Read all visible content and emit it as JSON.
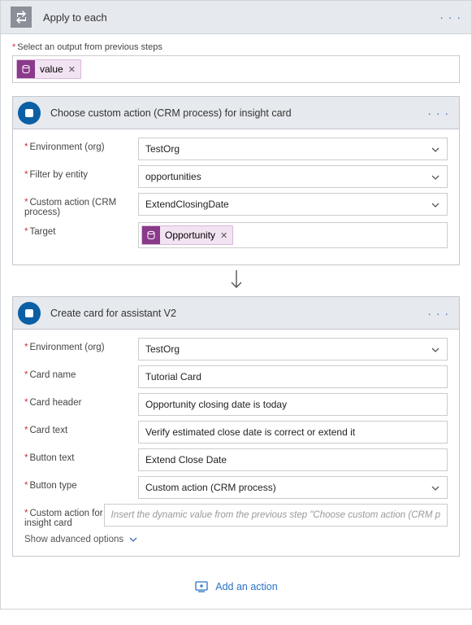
{
  "outer": {
    "title": "Apply to each",
    "selectLabel": "Select an output from previous steps",
    "pill": "value"
  },
  "action1": {
    "title": "Choose custom action (CRM process) for insight card",
    "env_label": "Environment (org)",
    "env_value": "TestOrg",
    "filter_label": "Filter by entity",
    "filter_value": "opportunities",
    "custom_label": "Custom action (CRM process)",
    "custom_value": "ExtendClosingDate",
    "target_label": "Target",
    "target_pill": "Opportunity"
  },
  "action2": {
    "title": "Create card for assistant V2",
    "env_label": "Environment (org)",
    "env_value": "TestOrg",
    "cardname_label": "Card name",
    "cardname_value": "Tutorial Card",
    "cardheader_label": "Card header",
    "cardheader_value": "Opportunity closing date is today",
    "cardtext_label": "Card text",
    "cardtext_value": "Verify estimated close date is correct or extend it",
    "btntext_label": "Button text",
    "btntext_value": "Extend Close Date",
    "btntype_label": "Button type",
    "btntype_value": "Custom action (CRM process)",
    "customaction_label": "Custom action for insight card",
    "customaction_placeholder": "Insert the dynamic value from the previous step \"Choose custom action (CRM p",
    "advanced": "Show advanced options"
  },
  "addAction": "Add an action"
}
